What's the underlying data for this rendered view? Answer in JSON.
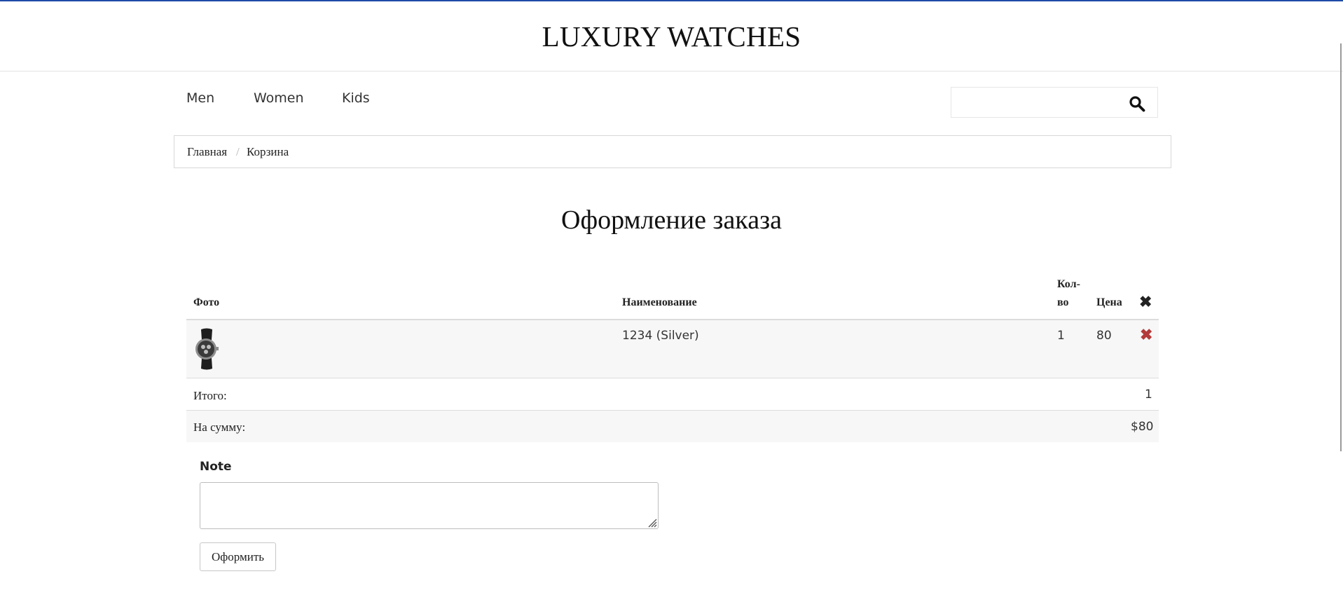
{
  "site": {
    "title": "LUXURY WATCHES"
  },
  "nav": {
    "items": [
      {
        "label": "Men"
      },
      {
        "label": "Women"
      },
      {
        "label": "Kids"
      }
    ]
  },
  "search": {
    "placeholder": "",
    "icon": "search-icon"
  },
  "breadcrumb": {
    "items": [
      {
        "label": "Главная"
      },
      {
        "label": "Корзина"
      }
    ],
    "separator": "/"
  },
  "page": {
    "title": "Оформление заказа"
  },
  "cart": {
    "headers": {
      "photo": "Фото",
      "name": "Наименование",
      "qty_line1": "Кол-",
      "qty_line2": "во",
      "price": "Цена",
      "remove_icon": "✖"
    },
    "items": [
      {
        "name": "1234 (Silver)",
        "qty": "1",
        "price": "80",
        "remove_icon": "✖"
      }
    ],
    "total_label": "Итого:",
    "total_value": "1",
    "sum_label": "На сумму:",
    "sum_value": "$80"
  },
  "note": {
    "label": "Note",
    "value": ""
  },
  "submit": {
    "label": "Оформить"
  },
  "colors": {
    "accent_line": "#1f4aa8",
    "remove_red": "#b33a3a",
    "row_stripe": "#f7f7f7"
  }
}
